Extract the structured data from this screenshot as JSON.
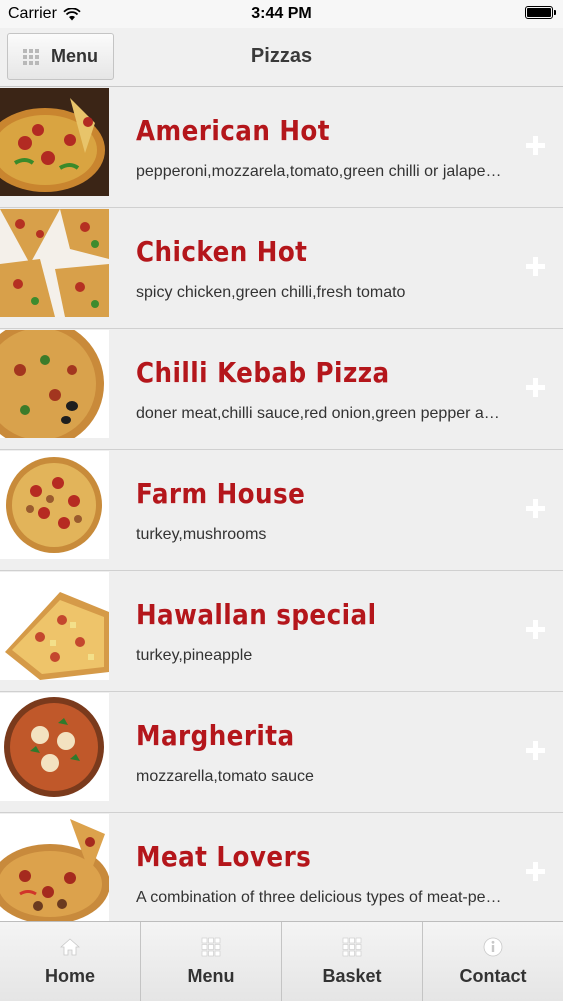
{
  "status_bar": {
    "carrier": "Carrier",
    "time": "3:44 PM",
    "battery_level": 1.0
  },
  "nav": {
    "menu_label": "Menu",
    "title": "Pizzas"
  },
  "items": [
    {
      "name": "American Hot",
      "description": "pepperoni,mozzarela,tomato,green chilli or jalapeno peppers"
    },
    {
      "name": "Chicken Hot",
      "description": "spicy chicken,green chilli,fresh tomato"
    },
    {
      "name": "Chilli Kebab Pizza",
      "description": "doner meat,chilli sauce,red onion,green pepper and jalapenos"
    },
    {
      "name": "Farm House",
      "description": "turkey,mushrooms"
    },
    {
      "name": "Hawallan special",
      "description": "turkey,pineapple"
    },
    {
      "name": "Margherita",
      "description": "mozzarella,tomato sauce"
    },
    {
      "name": "Meat Lovers",
      "description": "A combination of three delicious types of meat-pepperoni"
    }
  ],
  "tabs": [
    {
      "label": "Home",
      "icon": "home-icon"
    },
    {
      "label": "Menu",
      "icon": "grid-icon"
    },
    {
      "label": "Basket",
      "icon": "grid-icon"
    },
    {
      "label": "Contact",
      "icon": "info-icon"
    }
  ],
  "colors": {
    "item_name": "#b4161b",
    "accent_plus": "#ffffff",
    "background": "#f0f0f0"
  }
}
